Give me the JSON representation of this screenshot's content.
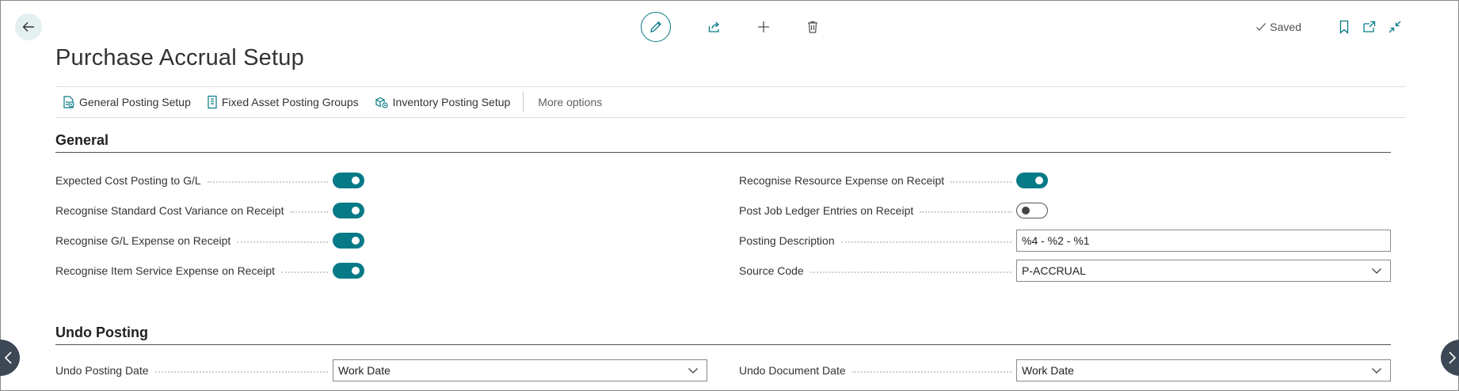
{
  "title": "Purchase Accrual Setup",
  "status": {
    "saved_label": "Saved"
  },
  "actions": [
    {
      "label": "General Posting Setup",
      "icon": "general-posting-setup-icon"
    },
    {
      "label": "Fixed Asset Posting Groups",
      "icon": "fixed-asset-icon"
    },
    {
      "label": "Inventory Posting Setup",
      "icon": "inventory-posting-icon"
    }
  ],
  "more_options_label": "More options",
  "general": {
    "title": "General",
    "left": [
      {
        "label": "Expected Cost Posting to G/L",
        "value": true
      },
      {
        "label": "Recognise Standard Cost Variance on Receipt",
        "value": true
      },
      {
        "label": "Recognise G/L Expense on Receipt",
        "value": true
      },
      {
        "label": "Recognise Item Service Expense on Receipt",
        "value": true
      }
    ],
    "right": {
      "resource_expense": {
        "label": "Recognise Resource Expense on Receipt",
        "value": true
      },
      "job_ledger": {
        "label": "Post Job Ledger Entries on Receipt",
        "value": false
      },
      "posting_description": {
        "label": "Posting Description",
        "value": "%4 - %2 - %1"
      },
      "source_code": {
        "label": "Source Code",
        "value": "P-ACCRUAL"
      }
    }
  },
  "undo_posting": {
    "title": "Undo Posting",
    "undo_posting_date": {
      "label": "Undo Posting Date",
      "value": "Work Date"
    },
    "undo_document_date": {
      "label": "Undo Document Date",
      "value": "Work Date"
    }
  },
  "colors": {
    "accent": "#067a87",
    "side_nav": "#3d4856"
  }
}
